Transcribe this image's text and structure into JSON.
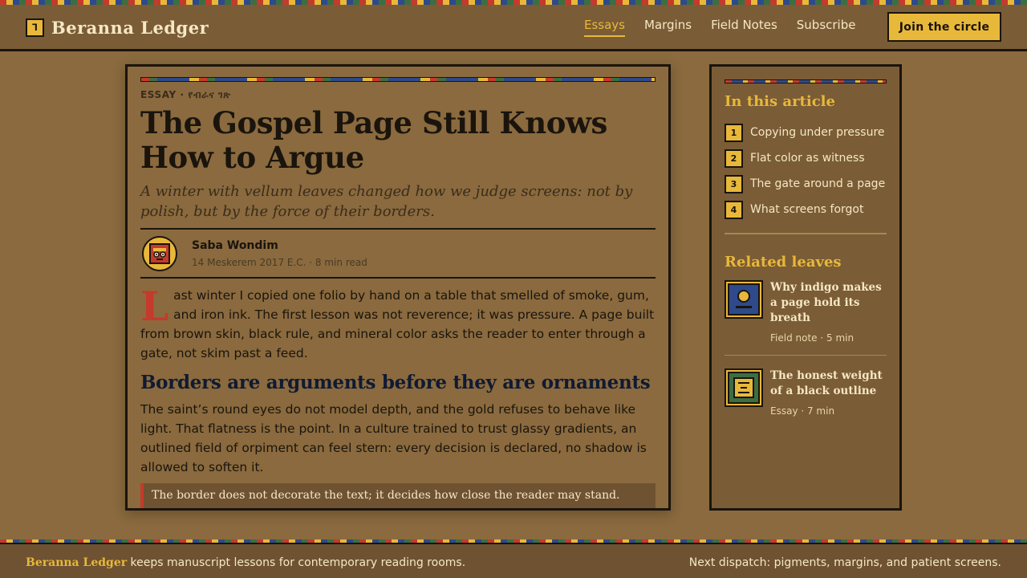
{
  "header": {
    "brand_mark": "ᒣ",
    "brand_name": "Beranna Ledger",
    "nav": [
      "Essays",
      "Margins",
      "Field Notes",
      "Subscribe"
    ],
    "cta": "Join the circle"
  },
  "article": {
    "kicker": "ESSAY · የብራና ገጽ",
    "title": "The Gospel Page Still Knows How to Argue",
    "dek": "A winter with vellum leaves changed how we judge screens: not by polish, but by the force of their borders.",
    "author": "Saba Wondim",
    "meta": "14 Meskerem 2017 E.C. · 8 min read",
    "dropcap": "L",
    "lede": "ast winter I copied one folio by hand on a table that smelled of smoke, gum, and iron ink. The first lesson was not reverence; it was pressure. A page built from brown skin, black rule, and mineral color asks the reader to enter through a gate, not skim past a feed.",
    "heading": "Borders are arguments before they are ornaments",
    "body": "The saint’s round eyes do not model depth, and the gold refuses to behave like light. That flatness is the point. In a culture trained to trust glassy gradients, an outlined field of orpiment can feel stern: every decision is declared, no shadow is allowed to soften it.",
    "pull": "The border does not decorate the text; it decides how close the reader may stand."
  },
  "sidebar": {
    "toc_heading": "In this article",
    "toc": [
      {
        "num": "1",
        "label": "Copying under pressure"
      },
      {
        "num": "2",
        "label": "Flat color as witness"
      },
      {
        "num": "3",
        "label": "The gate around a page"
      },
      {
        "num": "4",
        "label": "What screens forgot"
      }
    ],
    "related_heading": "Related leaves",
    "related": [
      {
        "title": "Why indigo makes a page hold its breath",
        "meta": "Field note · 5 min"
      },
      {
        "title": "The honest weight of a black outline",
        "meta": "Essay · 7 min"
      }
    ]
  },
  "footer": {
    "brand": "Beranna Ledger",
    "tagline": " keeps manuscript lessons for contemporary reading rooms.",
    "right": "Next dispatch: pigments, margins, and patient screens."
  },
  "colors": {
    "page_bg": "#8a6a3e",
    "header_bg": "#7a5c36",
    "gold": "#e8b83a",
    "ink": "#1a140d",
    "red": "#c43a2c",
    "indigo": "#2e4a8a",
    "green": "#3d6e42",
    "cream": "#f6e7c5"
  }
}
